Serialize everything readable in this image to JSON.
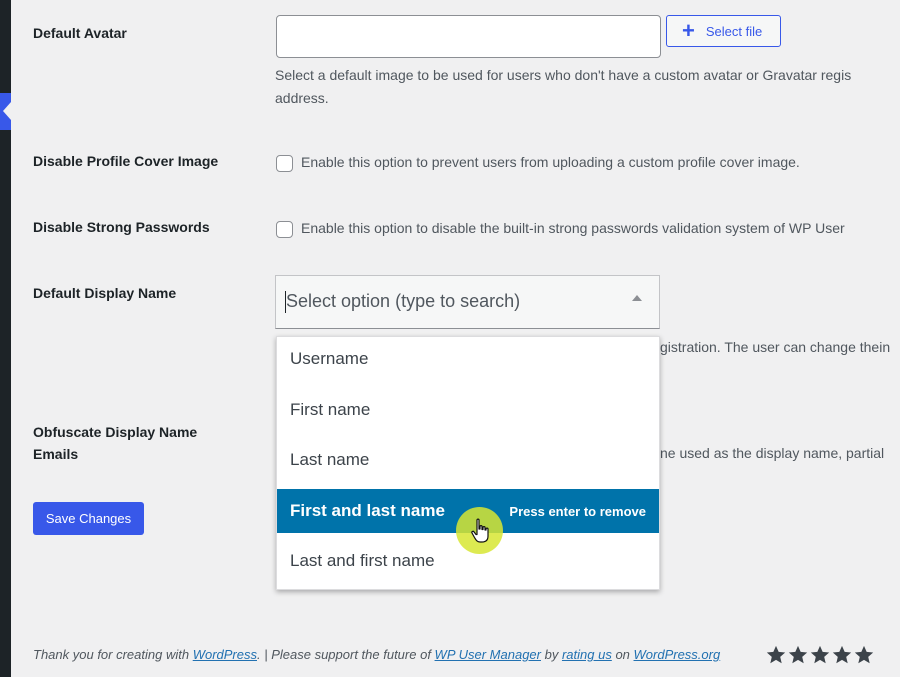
{
  "settings": {
    "default_avatar": {
      "label": "Default Avatar",
      "button_label": "Select file",
      "desc_line1": "Select a default image to be used for users who don't have a custom avatar or Gravatar regis",
      "desc_line2": "address."
    },
    "disable_cover": {
      "label": "Disable Profile Cover Image",
      "desc": "Enable this option to prevent users from uploading a custom profile cover image."
    },
    "disable_strong_pw": {
      "label": "Disable Strong Passwords",
      "desc": "Enable this option to disable the built-in strong passwords validation system of WP User"
    },
    "default_display_name": {
      "label": "Default Display Name",
      "placeholder": "Select option (type to search)",
      "desc_partial": "gistration. The user can change thein",
      "options": [
        "Username",
        "First name",
        "Last name",
        "First and last name",
        "Last and first name"
      ],
      "selected_index": 3,
      "selected_hint": "Press enter to remove"
    },
    "obfuscate": {
      "label_line1": "Obfuscate Display Name",
      "label_line2": "Emails",
      "desc_partial": "ne used as the display name, partial"
    }
  },
  "save_label": "Save Changes",
  "footer": {
    "text1": "Thank you for creating with ",
    "link1": "WordPress",
    "text2": ". | Please support the future of ",
    "link2": "WP User Manager",
    "text3": " by ",
    "link3": "rating us",
    "text4": " on ",
    "link4": "WordPress.org",
    "rating_stars": 5
  },
  "colors": {
    "accent": "#3858e9",
    "selected_option": "#0073aa",
    "cursor_highlight": "#d7e632"
  }
}
